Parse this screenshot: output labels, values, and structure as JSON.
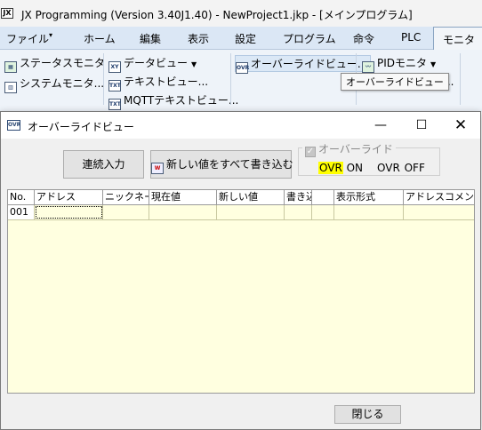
{
  "app": {
    "logo": "JX",
    "title": "JX Programming (Version 3.40J1.40) - NewProject1.jkp - [メインプログラム]"
  },
  "menubar": {
    "items": [
      "ファイル",
      "ホーム",
      "編集",
      "表示",
      "設定",
      "プログラム",
      "命令",
      "PLC",
      "モニタ"
    ],
    "active": "モニタ"
  },
  "ribbon": {
    "status_monitor": "ステータスモニタ",
    "system_monitor": "システムモニタ...",
    "data_view": "データビュー",
    "text_view": "テキストビュー...",
    "mqtt_text_view": "MQTTテキストビュー...",
    "override_view": "オーバーライドビュー...",
    "pid_monitor": "PIDモニタ",
    "partial_label": "ュー...",
    "tooltip": "オーバーライドビュー"
  },
  "dialog": {
    "icon": "OVR",
    "title": "オーバーライドビュー",
    "continuous_input": "連続入力",
    "write_all_new": "新しい値をすべて書き込む",
    "override_label": "オーバーライド",
    "ovr_on_tag": "OVR",
    "ovr_on_label": "ON",
    "ovr_off_tag": "OVR",
    "ovr_off_label": "OFF",
    "close": "閉じる"
  },
  "table": {
    "columns": [
      "No.",
      "アドレス",
      "ニックネーム",
      "現在値",
      "新しい値",
      "書き込",
      "",
      "表示形式",
      "アドレスコメント"
    ],
    "rows": [
      {
        "no": "001",
        "address": "",
        "nickname": "",
        "current": "",
        "new": "",
        "write": "",
        "extra": "",
        "format": "",
        "comment": ""
      }
    ]
  },
  "colors": {
    "grid_background": "#ffffe0",
    "ovr_on_highlight": "#ffff00",
    "ribbon_background": "#eef3f9"
  }
}
